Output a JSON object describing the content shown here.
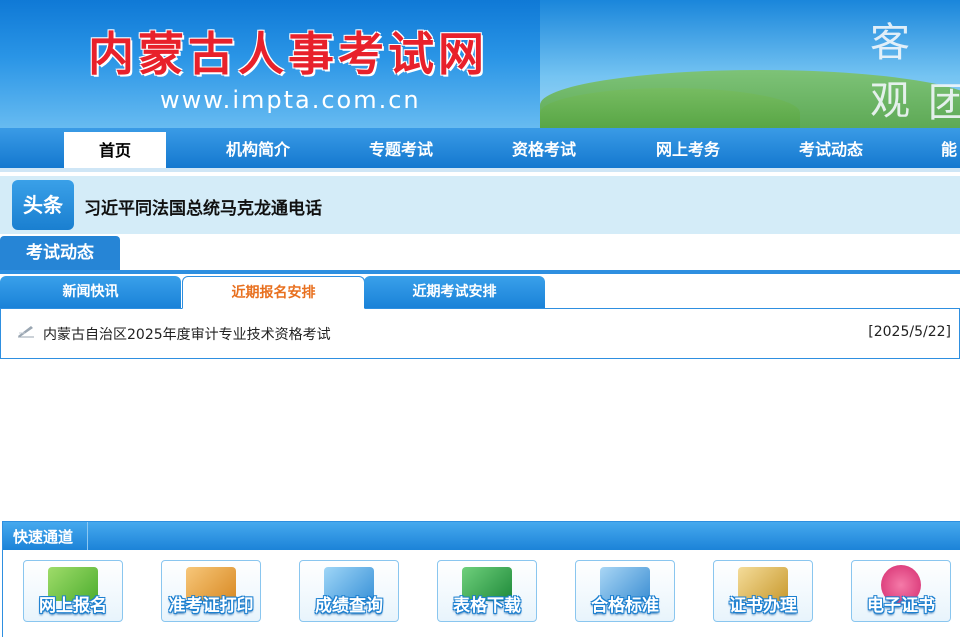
{
  "header": {
    "site_title": "内蒙古人事考试网",
    "site_url": "www.impta.com.cn",
    "slogan_line1": "客 观",
    "slogan_line2": "团"
  },
  "nav": {
    "items": [
      "首页",
      "机构简介",
      "专题考试",
      "资格考试",
      "网上考务",
      "考试动态",
      "能"
    ],
    "active_index": 0
  },
  "headline": {
    "badge": "头条",
    "text": "习近平同法国总统马克龙通电话"
  },
  "section": {
    "title": "考试动态"
  },
  "tabs": {
    "items": [
      "新闻快讯",
      "近期报名安排",
      "近期考试安排"
    ],
    "active_index": 1
  },
  "news": [
    {
      "icon": "pen-icon",
      "title": "内蒙古自治区2025年度审计专业技术资格考试",
      "date": "[2025/5/22]"
    }
  ],
  "quick": {
    "title": "快速通道",
    "buttons": [
      {
        "label": "网上报名",
        "icon": "register-icon",
        "color": "#7ac943"
      },
      {
        "label": "准考证打印",
        "icon": "printer-icon",
        "color": "#f2a03d"
      },
      {
        "label": "成绩查询",
        "icon": "search-icon",
        "color": "#4ea8e6"
      },
      {
        "label": "表格下载",
        "icon": "excel-icon",
        "color": "#2e9e4a"
      },
      {
        "label": "合格标准",
        "icon": "chart-icon",
        "color": "#5aa7e0"
      },
      {
        "label": "证书办理",
        "icon": "certificate-icon",
        "color": "#e0b04a"
      },
      {
        "label": "电子证书",
        "icon": "ecert-icon",
        "color": "#e84a8a"
      }
    ]
  },
  "colors": {
    "primary": "#1a7fd0",
    "accent_orange": "#e8701f",
    "title_red": "#e8212b"
  }
}
